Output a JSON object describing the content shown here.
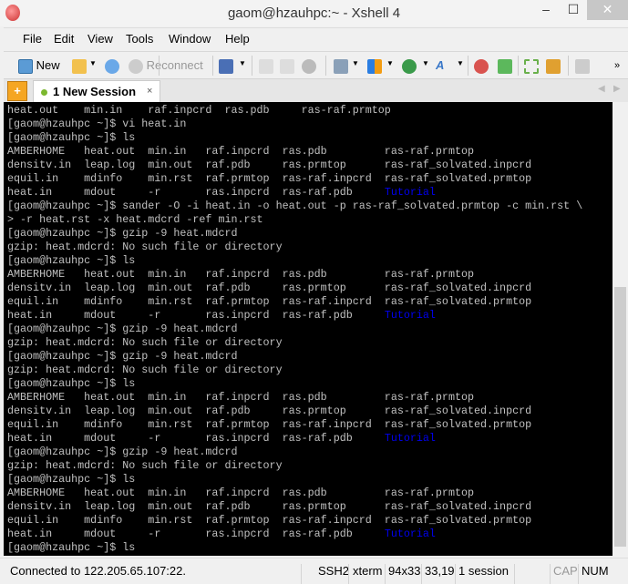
{
  "window": {
    "title": "gaom@hzauhpc:~ - Xshell 4",
    "minimize": "–",
    "maximize": "☐",
    "close": "✕"
  },
  "menu": [
    "File",
    "Edit",
    "View",
    "Tools",
    "Window",
    "Help"
  ],
  "toolbar": {
    "new_label": "New",
    "reconnect_label": "Reconnect",
    "more": "»"
  },
  "tabs": [
    {
      "label": "1 New Session",
      "close": "×",
      "status_color": "#7cb82f"
    }
  ],
  "add_tab": "+",
  "terminal": {
    "lines": [
      {
        "t": "heat.out    min.in    raf.inpcrd  ras.pdb     ras-raf.prmtop"
      },
      {
        "t": "[gaom@hzauhpc ~]$ vi heat.in"
      },
      {
        "t": "[gaom@hzauhpc ~]$ ls"
      },
      {
        "t": "AMBERHOME   heat.out  min.in   raf.inpcrd  ras.pdb         ras-raf.prmtop"
      },
      {
        "t": "densitv.in  leap.log  min.out  raf.pdb     ras.prmtop      ras-raf_solvated.inpcrd"
      },
      {
        "t": "equil.in    mdinfo    min.rst  raf.prmtop  ras-raf.inpcrd  ras-raf_solvated.prmtop"
      },
      {
        "t": "heat.in     mdout     -r       ras.inpcrd  ras-raf.pdb     ",
        "b": "Tutorial"
      },
      {
        "t": "[gaom@hzauhpc ~]$ sander -O -i heat.in -o heat.out -p ras-raf_solvated.prmtop -c min.rst \\"
      },
      {
        "t": "> -r heat.rst -x heat.mdcrd -ref min.rst"
      },
      {
        "t": "[gaom@hzauhpc ~]$ gzip -9 heat.mdcrd"
      },
      {
        "t": "gzip: heat.mdcrd: No such file or directory"
      },
      {
        "t": "[gaom@hzauhpc ~]$ ls"
      },
      {
        "t": "AMBERHOME   heat.out  min.in   raf.inpcrd  ras.pdb         ras-raf.prmtop"
      },
      {
        "t": "densitv.in  leap.log  min.out  raf.pdb     ras.prmtop      ras-raf_solvated.inpcrd"
      },
      {
        "t": "equil.in    mdinfo    min.rst  raf.prmtop  ras-raf.inpcrd  ras-raf_solvated.prmtop"
      },
      {
        "t": "heat.in     mdout     -r       ras.inpcrd  ras-raf.pdb     ",
        "b": "Tutorial"
      },
      {
        "t": "[gaom@hzauhpc ~]$ gzip -9 heat.mdcrd"
      },
      {
        "t": "gzip: heat.mdcrd: No such file or directory"
      },
      {
        "t": "[gaom@hzauhpc ~]$ gzip -9 heat.mdcrd"
      },
      {
        "t": "gzip: heat.mdcrd: No such file or directory"
      },
      {
        "t": "[gaom@hzauhpc ~]$ ls"
      },
      {
        "t": "AMBERHOME   heat.out  min.in   raf.inpcrd  ras.pdb         ras-raf.prmtop"
      },
      {
        "t": "densitv.in  leap.log  min.out  raf.pdb     ras.prmtop      ras-raf_solvated.inpcrd"
      },
      {
        "t": "equil.in    mdinfo    min.rst  raf.prmtop  ras-raf.inpcrd  ras-raf_solvated.prmtop"
      },
      {
        "t": "heat.in     mdout     -r       ras.inpcrd  ras-raf.pdb     ",
        "b": "Tutorial"
      },
      {
        "t": "[gaom@hzauhpc ~]$ gzip -9 heat.mdcrd"
      },
      {
        "t": "gzip: heat.mdcrd: No such file or directory"
      },
      {
        "t": "[gaom@hzauhpc ~]$ ls"
      },
      {
        "t": "AMBERHOME   heat.out  min.in   raf.inpcrd  ras.pdb         ras-raf.prmtop"
      },
      {
        "t": "densitv.in  leap.log  min.out  raf.pdb     ras.prmtop      ras-raf_solvated.inpcrd"
      },
      {
        "t": "equil.in    mdinfo    min.rst  raf.prmtop  ras-raf.inpcrd  ras-raf_solvated.prmtop"
      },
      {
        "t": "heat.in     mdout     -r       ras.inpcrd  ras-raf.pdb     ",
        "b": "Tutorial"
      },
      {
        "t": "[gaom@hzauhpc ~]$ ls"
      }
    ]
  },
  "status": {
    "connection": "Connected to 122.205.65.107:22.",
    "protocol": "SSH2",
    "term": "xterm",
    "size": "94x33",
    "cursor": "33,19",
    "sessions": "1 session",
    "cap": "CAP",
    "num": "NUM"
  }
}
